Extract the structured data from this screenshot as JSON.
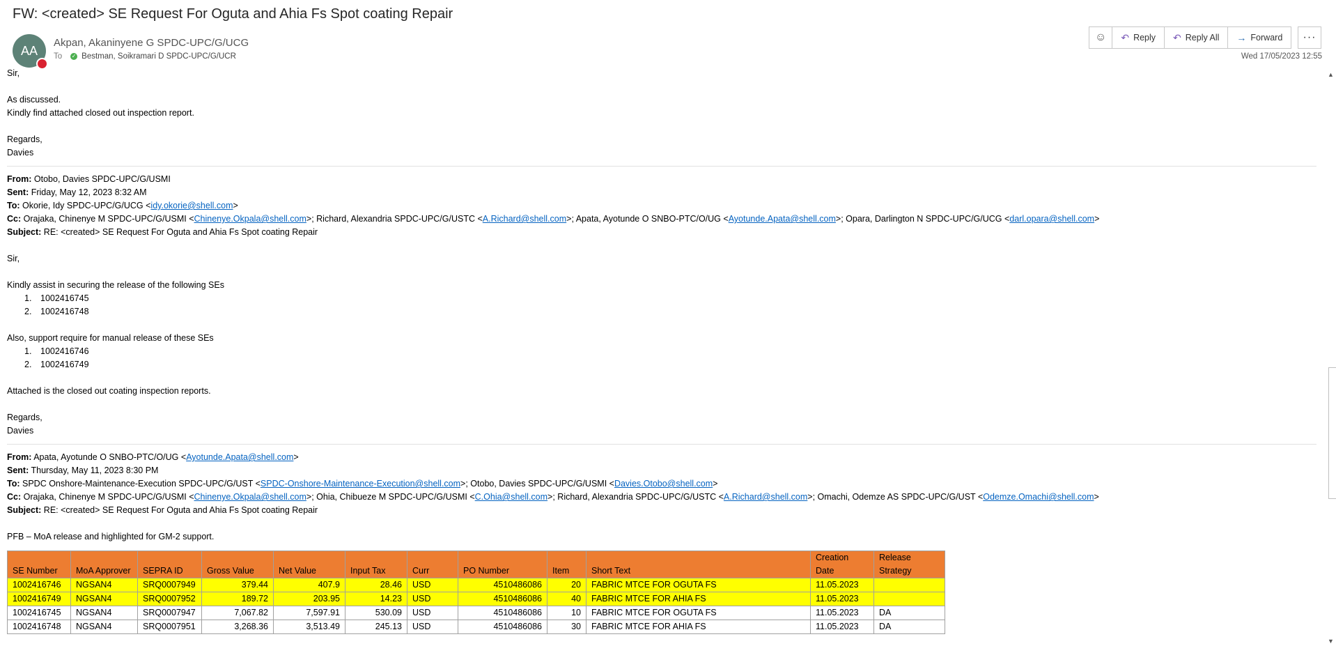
{
  "subject": "FW: <created> SE Request For Oguta and Ahia Fs Spot coating Repair",
  "header": {
    "avatar_initials": "AA",
    "sender": "Akpan, Akaninyene G SPDC-UPC/G/UCG",
    "to_label": "To",
    "recipient": "Bestman, Soikramari D SPDC-UPC/G/UCR",
    "date": "Wed 17/05/2023 12:55",
    "actions": {
      "reply": "Reply",
      "reply_all": "Reply All",
      "forward": "Forward",
      "more": "···"
    }
  },
  "message": {
    "greeting": "Sir,",
    "line1": "As discussed.",
    "line2": "Kindly find attached closed out inspection report.",
    "regards": "Regards,",
    "signature": "Davies"
  },
  "forward1": {
    "from_label": "From:",
    "from": "Otobo, Davies SPDC-UPC/G/USMI",
    "sent_label": "Sent:",
    "sent": "Friday, May 12, 2023 8:32 AM",
    "to_label": "To:",
    "to_name": "Okorie, Idy SPDC-UPC/G/UCG <",
    "to_email": "idy.okorie@shell.com",
    "to_end": ">",
    "cc_label": "Cc:",
    "cc1_name": "Orajaka, Chinenye M SPDC-UPC/G/USMI <",
    "cc1_email": "Chinenye.Okpala@shell.com",
    "cc2_name": ">; Richard, Alexandria SPDC-UPC/G/USTC <",
    "cc2_email": "A.Richard@shell.com",
    "cc3_name": ">; Apata, Ayotunde O SNBO-PTC/O/UG <",
    "cc3_email": "Ayotunde.Apata@shell.com",
    "cc4_name": ">; Opara, Darlington N SPDC-UPC/G/UCG <",
    "cc4_email": "darl.opara@shell.com",
    "cc_end": ">",
    "subject_label": "Subject:",
    "subject": "RE: <created> SE Request For Oguta and Ahia Fs Spot coating Repair",
    "greeting": "Sir,",
    "intro": "Kindly assist in securing the release of the following SEs",
    "list1": [
      "1002416745",
      "1002416748"
    ],
    "also": "Also, support require for manual release of these SEs",
    "list2": [
      "1002416746",
      "1002416749"
    ],
    "attached": "Attached is the closed out coating inspection reports.",
    "regards": "Regards,",
    "signature": "Davies"
  },
  "forward2": {
    "from_label": "From:",
    "from_name": "Apata, Ayotunde O SNBO-PTC/O/UG <",
    "from_email": "Ayotunde.Apata@shell.com",
    "from_end": ">",
    "sent_label": "Sent:",
    "sent": "Thursday, May 11, 2023 8:30 PM",
    "to_label": "To:",
    "to1_name": "SPDC Onshore-Maintenance-Execution SPDC-UPC/G/UST <",
    "to1_email": "SPDC-Onshore-Maintenance-Execution@shell.com",
    "to2_name": ">; Otobo, Davies SPDC-UPC/G/USMI <",
    "to2_email": "Davies.Otobo@shell.com",
    "to_end": ">",
    "cc_label": "Cc:",
    "cc1_name": "Orajaka, Chinenye M SPDC-UPC/G/USMI <",
    "cc1_email": "Chinenye.Okpala@shell.com",
    "cc2_name": ">; Ohia, Chibueze M SPDC-UPC/G/USMI <",
    "cc2_email": "C.Ohia@shell.com",
    "cc3_name": ">; Richard, Alexandria SPDC-UPC/G/USTC <",
    "cc3_email": "A.Richard@shell.com",
    "cc4_name": ">; Omachi, Odemze AS SPDC-UPC/G/UST <",
    "cc4_email": "Odemze.Omachi@shell.com",
    "cc_end": ">",
    "subject_label": "Subject:",
    "subject": "RE: <created> SE Request For Oguta and Ahia Fs Spot coating Repair",
    "pfb": "PFB – MoA release and highlighted for GM-2 support."
  },
  "table": {
    "headers": [
      "SE Number",
      "MoA Approver",
      "SEPRA ID",
      "Gross Value",
      "Net Value",
      "Input Tax",
      "Curr",
      "PO Number",
      "Item",
      "Short Text",
      "Creation Date",
      "Release Strategy"
    ],
    "rows": [
      [
        "1002416746",
        "NGSAN4",
        "SRQ0007949",
        "379.44",
        "407.9",
        "28.46",
        "USD",
        "4510486086",
        "20",
        "FABRIC MTCE FOR OGUTA FS",
        "11.05.2023",
        ""
      ],
      [
        "1002416749",
        "NGSAN4",
        "SRQ0007952",
        "189.72",
        "203.95",
        "14.23",
        "USD",
        "4510486086",
        "40",
        "FABRIC MTCE FOR AHIA FS",
        "11.05.2023",
        ""
      ],
      [
        "1002416745",
        "NGSAN4",
        "SRQ0007947",
        "7,067.82",
        "7,597.91",
        "530.09",
        "USD",
        "4510486086",
        "10",
        "FABRIC MTCE FOR OGUTA FS",
        "11.05.2023",
        "DA"
      ],
      [
        "1002416748",
        "NGSAN4",
        "SRQ0007951",
        "3,268.36",
        "3,513.49",
        "245.13",
        "USD",
        "4510486086",
        "30",
        "FABRIC MTCE FOR AHIA FS",
        "11.05.2023",
        "DA"
      ]
    ],
    "highlight_color": "#ffff00",
    "header_color": "#ed7d31"
  }
}
